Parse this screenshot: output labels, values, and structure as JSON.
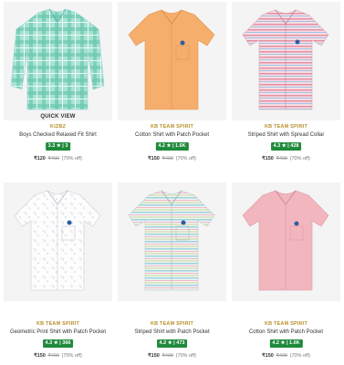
{
  "products": [
    {
      "brand": "KIZBZ",
      "title": "Boys Checked Relaxed Fit Shirt",
      "rating": "3.3 ★ | 3",
      "price": "₹120",
      "mrp": "₹400",
      "discount": "(70% off)",
      "quick_view": "QUICK VIEW",
      "shirt_color": "#8fd8c7",
      "pattern": "check-teal"
    },
    {
      "brand": "KB TEAM SPIRIT",
      "title": "Cotton Shirt with Patch Pocket",
      "rating": "4.2 ★ | 1.6K",
      "price": "₹150",
      "mrp": "₹499",
      "discount": "(70% off)",
      "shirt_color": "#f6ae6c",
      "pattern": "solid"
    },
    {
      "brand": "KB TEAM SPIRIT",
      "title": "Striped Shirt with Spread Collar",
      "rating": "4.3 ★ | 428",
      "price": "₹150",
      "mrp": "₹499",
      "discount": "(70% off)",
      "shirt_color": "#f2cfd8",
      "pattern": "stripe-pink"
    },
    {
      "brand": "KB TEAM SPIRIT",
      "title": "Geometric Print Shirt with Patch Pocket",
      "rating": "4.3 ★ | 366",
      "price": "₹150",
      "mrp": "₹499",
      "discount": "(70% off)",
      "shirt_color": "#fbfbfb",
      "pattern": "print-white"
    },
    {
      "brand": "KB TEAM SPIRIT",
      "title": "Striped Shirt with Patch Pocket",
      "rating": "4.2 ★ | 473",
      "price": "₹150",
      "mrp": "₹499",
      "discount": "(70% off)",
      "shirt_color": "#d6e6ea",
      "pattern": "stripe-pastel"
    },
    {
      "brand": "KB TEAM SPIRIT",
      "title": "Cotton Shirt with Patch Pocket",
      "rating": "4.2 ★ | 1.6K",
      "price": "₹150",
      "mrp": "₹499",
      "discount": "(70% off)",
      "shirt_color": "#f2b6bf",
      "pattern": "solid"
    }
  ],
  "colors": {
    "brand_text": "#b8902d",
    "rating_bg": "#1f8a3b",
    "image_bg": "#f4f4f4"
  }
}
